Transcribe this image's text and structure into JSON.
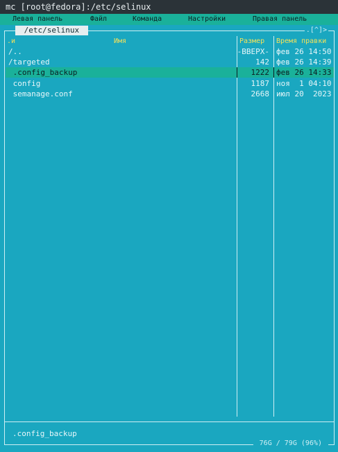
{
  "window": {
    "title": "mc [root@fedora]:/etc/selinux"
  },
  "menu": {
    "items": [
      "Левая панель",
      "Файл",
      "Команда",
      "Настройки",
      "Правая панель"
    ]
  },
  "panel": {
    "path": " /etc/selinux ",
    "corner": ".[^]>",
    "columns": {
      "sort_marker": ".и",
      "name": "Имя",
      "size": "Размер",
      "time": "Время правки"
    },
    "rows": [
      {
        "name": "/..",
        "size": "-ВВЕРХ-",
        "time": "фев 26 14:50",
        "selected": false
      },
      {
        "name": "/targeted",
        "size": "142",
        "time": "фев 26 14:39",
        "selected": false
      },
      {
        "name": " .config_backup",
        "size": "1222",
        "time": "фев 26 14:33",
        "selected": true
      },
      {
        "name": " config",
        "size": "1187",
        "time": "ноя  1 04:10",
        "selected": false
      },
      {
        "name": " semanage.conf",
        "size": "2668",
        "time": "июл 20  2023",
        "selected": false
      }
    ],
    "mini_status": ".config_backup",
    "disk_info": " 76G / 79G (96%) "
  },
  "colors": {
    "panel_bg": "#1aa7c0",
    "menu_bg": "#1ab19a",
    "selection_bg": "#1ab19a",
    "header_fg": "#f3e25a",
    "titlebar_bg": "#2b3338"
  }
}
